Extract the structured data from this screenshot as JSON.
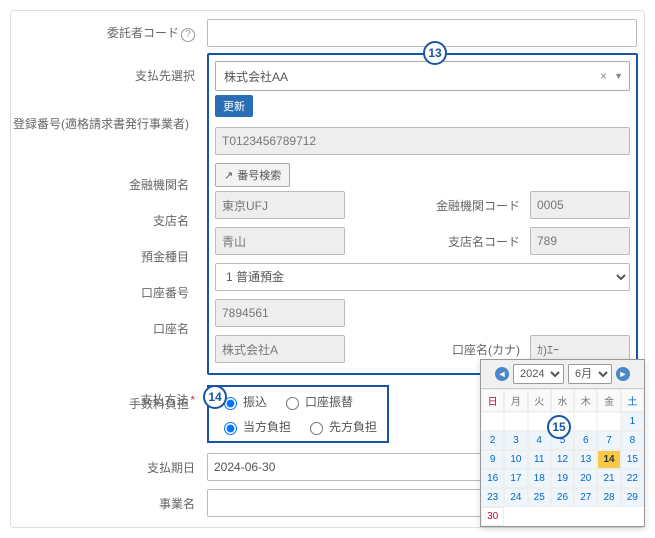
{
  "callouts": {
    "c13": "13",
    "c14": "14",
    "c15": "15"
  },
  "labels": {
    "consignor_code": "委託者コード",
    "payee_select": "支払先選択",
    "reg_number": "登録番号(適格請求書発行事業者)",
    "search_btn": "番号検索",
    "bank_name": "金融機関名",
    "bank_code": "金融機関コード",
    "branch_name": "支店名",
    "branch_code": "支店名コード",
    "account_type": "預金種目",
    "account_number": "口座番号",
    "account_name": "口座名",
    "account_name_kana": "口座名(カナ)",
    "pay_method": "支払方法",
    "fee_bearer": "手数料負担",
    "pay_due": "支払期日",
    "business_name": "事業名"
  },
  "values": {
    "consignor_code": "",
    "payee": "株式会社AA",
    "update_badge": "更新",
    "reg_number": "T0123456789712",
    "bank_name": "東京UFJ",
    "bank_code": "0005",
    "branch_name": "青山",
    "branch_code": "789",
    "account_type": "1 普通預金",
    "account_number": "7894561",
    "account_name": "株式会社A",
    "account_name_kana": "ｶ)ｴｰ",
    "pay_due": "2024-06-30",
    "business_name": ""
  },
  "radios": {
    "pay_method": {
      "transfer": "振込",
      "debit": "口座振替",
      "selected": "transfer"
    },
    "fee_bearer": {
      "ours": "当方負担",
      "theirs": "先方負担",
      "selected": "ours"
    }
  },
  "calendar": {
    "year": "2024",
    "month": "6月",
    "dow": [
      "日",
      "月",
      "火",
      "水",
      "木",
      "金",
      "土"
    ],
    "leading_blanks": 6,
    "days": 30,
    "today": 14
  }
}
